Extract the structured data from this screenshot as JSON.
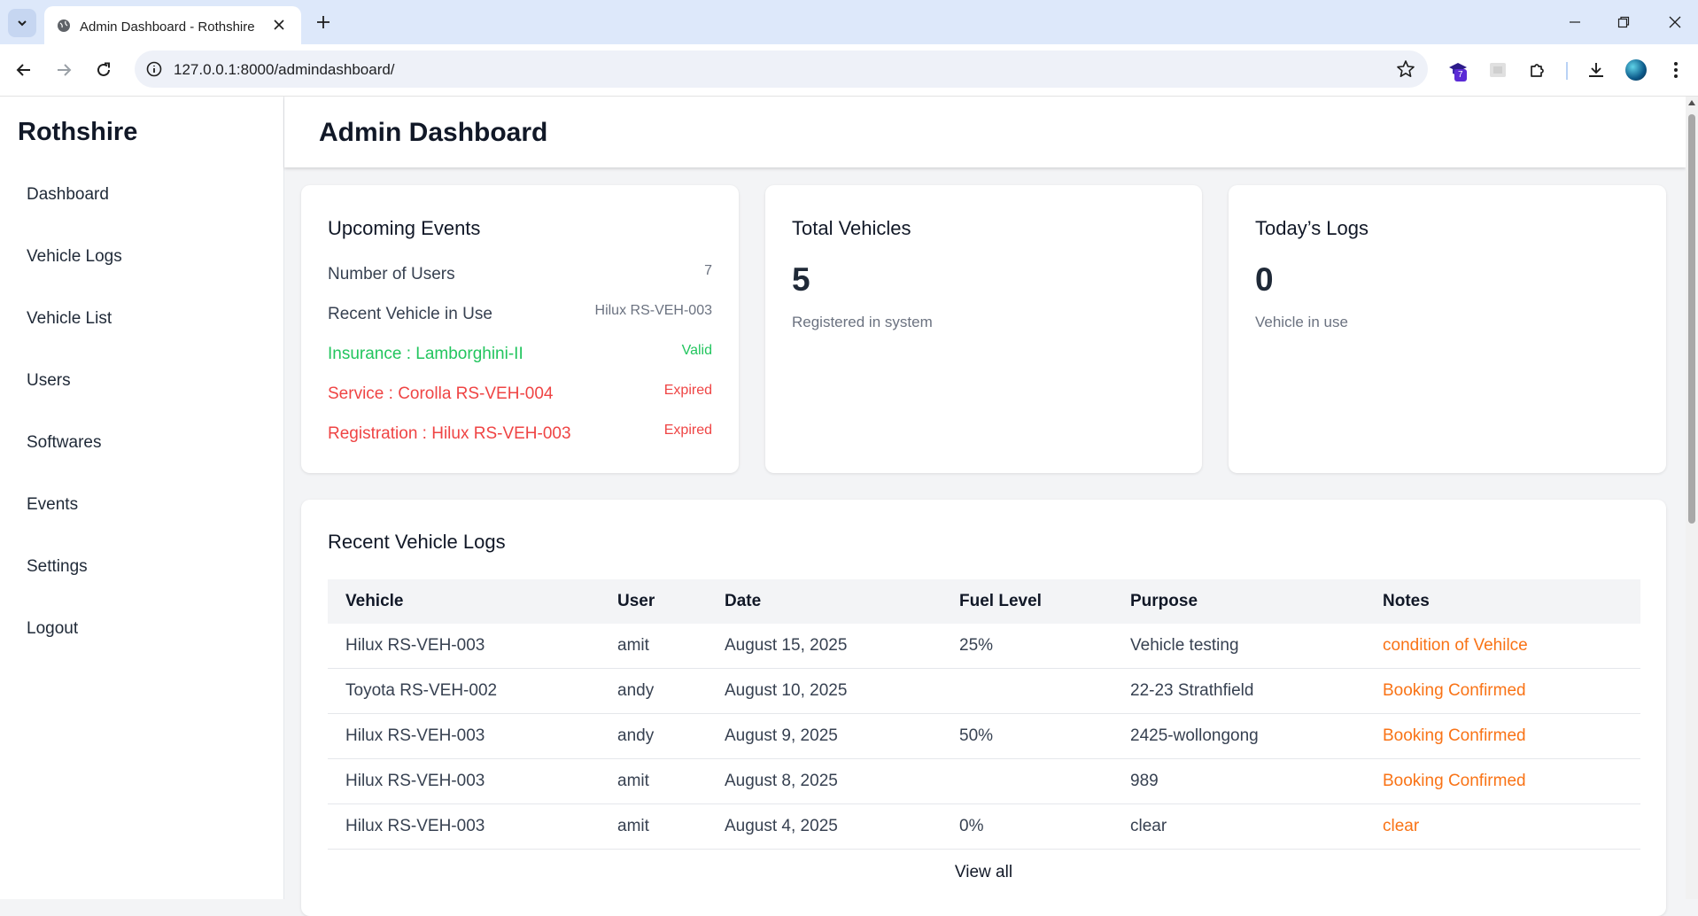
{
  "browser": {
    "tab_title": "Admin Dashboard - Rothshire",
    "url": "127.0.0.1:8000/admindashboard/",
    "extension_badge": "7"
  },
  "sidebar": {
    "brand": "Rothshire",
    "items": [
      {
        "label": "Dashboard"
      },
      {
        "label": "Vehicle Logs"
      },
      {
        "label": "Vehicle List"
      },
      {
        "label": "Users"
      },
      {
        "label": "Softwares"
      },
      {
        "label": "Events"
      },
      {
        "label": "Settings"
      },
      {
        "label": "Logout"
      }
    ]
  },
  "header": {
    "title": "Admin Dashboard"
  },
  "events": {
    "title": "Upcoming Events",
    "rows": [
      {
        "label": "Number of Users",
        "value": "7"
      },
      {
        "label": "Recent Vehicle in Use",
        "value": "Hilux RS-VEH-003"
      },
      {
        "label": "Insurance : Lamborghini-II",
        "value": "Valid"
      },
      {
        "label": "Service : Corolla RS-VEH-004",
        "value": "Expired"
      },
      {
        "label": "Registration : Hilux RS-VEH-003",
        "value": "Expired"
      }
    ]
  },
  "total_vehicles": {
    "title": "Total Vehicles",
    "value": "5",
    "subtitle": "Registered in system"
  },
  "todays_logs": {
    "title": "Today’s Logs",
    "value": "0",
    "subtitle": "Vehicle in use"
  },
  "recent_logs": {
    "title": "Recent Vehicle Logs",
    "columns": [
      "Vehicle",
      "User",
      "Date",
      "Fuel Level",
      "Purpose",
      "Notes"
    ],
    "rows": [
      [
        "Hilux RS-VEH-003",
        "amit",
        "August 15, 2025",
        "25%",
        "Vehicle testing",
        "condition of Vehilce"
      ],
      [
        "Toyota RS-VEH-002",
        "andy",
        "August 10, 2025",
        "",
        "22-23 Strathfield",
        "Booking Confirmed"
      ],
      [
        "Hilux RS-VEH-003",
        "andy",
        "August 9, 2025",
        "50%",
        "2425-wollongong",
        "Booking Confirmed"
      ],
      [
        "Hilux RS-VEH-003",
        "amit",
        "August 8, 2025",
        "",
        "989",
        "Booking Confirmed"
      ],
      [
        "Hilux RS-VEH-003",
        "amit",
        "August 4, 2025",
        "0%",
        "clear",
        "clear"
      ]
    ],
    "view_all": "View all"
  },
  "colors": {
    "valid": "#22c55e",
    "expired": "#ef4444",
    "note": "#f97316"
  }
}
